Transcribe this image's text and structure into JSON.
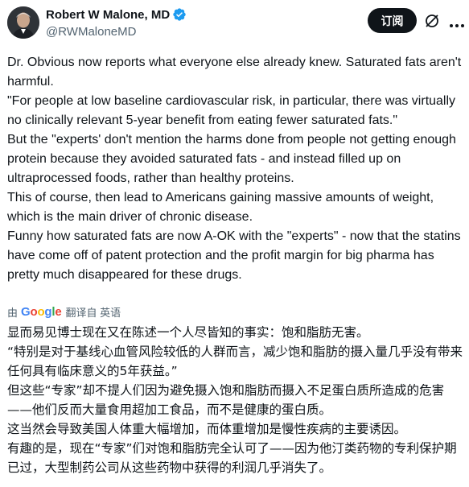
{
  "author": {
    "name": "Robert W Malone, MD",
    "handle": "@RWMaloneMD",
    "verified_color": "#1d9bf0"
  },
  "actions": {
    "subscribe_label": "订阅",
    "grok_icon": "grok-icon",
    "more_icon": "more-icon"
  },
  "post": {
    "lines": [
      "Dr. Obvious now reports what everyone else already knew.  Saturated fats aren't harmful.",
      "\"For people at low baseline cardiovascular risk, in particular, there was virtually no clinically relevant 5-year benefit from eating fewer saturated fats.\"",
      "But the \"experts' don't mention the harms done from people not getting enough protein because they avoided saturated fats - and instead filled up on ultraprocessed foods, rather than healthy proteins.",
      "This of course, then lead to Americans gaining massive amounts of weight, which is the main driver of chronic disease.",
      "Funny how saturated fats are now A-OK with the \"experts\" - now that the statins have come off of patent protection and the profit margin for big pharma has pretty much disappeared for these drugs."
    ]
  },
  "translation": {
    "by_label": "由",
    "provider": "Google",
    "translated_from": "翻译自 英语",
    "lines": [
      "显而易见博士现在又在陈述一个人尽皆知的事实：饱和脂肪无害。",
      "“特别是对于基线心血管风险较低的人群而言，减少饱和脂肪的摄入量几乎没有带来任何具有临床意义的5年获益。”",
      "但这些“专家”却不提人们因为避免摄入饱和脂肪而摄入不足蛋白质所造成的危害——他们反而大量食用超加工食品，而不是健康的蛋白质。",
      "这当然会导致美国人体重大幅增加，而体重增加是慢性疾病的主要诱因。",
      "有趣的是，现在“专家”们对饱和脂肪完全认可了——因为他汀类药物的专利保护期已过，大型制药公司从这些药物中获得的利润几乎消失了。"
    ]
  }
}
